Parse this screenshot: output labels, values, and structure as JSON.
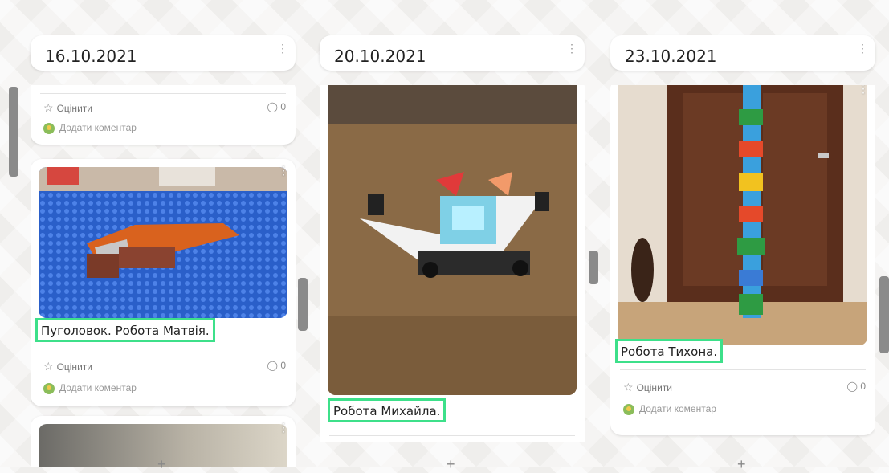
{
  "columns": [
    {
      "title": "16.10.2021",
      "cards": [
        {
          "rate_label": "Оцінити",
          "comment_count": "0",
          "add_comment": "Додати коментар"
        },
        {
          "caption": "Пуголовок. Робота Матвія.",
          "rate_label": "Оцінити",
          "comment_count": "0",
          "add_comment": "Додати коментар"
        }
      ]
    },
    {
      "title": "20.10.2021",
      "cards": [
        {
          "caption": "Робота Михайла."
        }
      ]
    },
    {
      "title": "23.10.2021",
      "cards": [
        {
          "caption": "Робота Тихона.",
          "rate_label": "Оцінити",
          "comment_count": "0",
          "add_comment": "Додати коментар"
        }
      ]
    }
  ],
  "icons": {
    "star": "star-outline-icon",
    "comment": "speech-bubble-icon",
    "menu": "kebab-menu-icon",
    "add": "plus-icon"
  },
  "colors": {
    "caption_highlight": "#3de08a",
    "background": "#efeeec"
  }
}
